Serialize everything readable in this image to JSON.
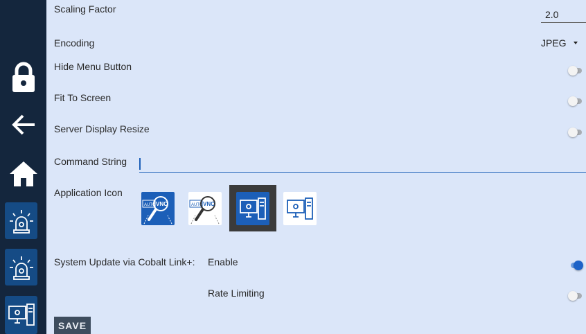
{
  "settings": {
    "scaling_factor": {
      "label": "Scaling Factor",
      "value": "2.0"
    },
    "encoding": {
      "label": "Encoding",
      "value": "JPEG"
    },
    "hide_menu_button": {
      "label": "Hide Menu Button",
      "on": false
    },
    "fit_to_screen": {
      "label": "Fit To Screen",
      "on": false
    },
    "server_display_resize": {
      "label": "Server Display Resize",
      "on": false
    },
    "command_string": {
      "label": "Command String",
      "value": ""
    },
    "application_icon": {
      "label": "Application Icon",
      "options": [
        {
          "name": "auto-vnc-dark",
          "badge": "AUTO",
          "text": "VNC",
          "selected": false
        },
        {
          "name": "auto-vnc-light",
          "badge": "AUTO",
          "text": "VNC",
          "selected": false
        },
        {
          "name": "computer-dark",
          "selected": true
        },
        {
          "name": "computer-light",
          "selected": false
        }
      ]
    },
    "system_update": {
      "label": "System Update via Cobalt Link+:",
      "sublabel": "Enable",
      "on": true
    },
    "rate_limiting": {
      "label": "Rate Limiting",
      "on": false
    }
  },
  "actions": {
    "save_label": "SAVE"
  },
  "rail": {
    "icons": [
      "lock-icon",
      "back-arrow-icon",
      "home-icon",
      "alarm-icon",
      "alarm-icon",
      "computer-icon"
    ]
  },
  "colors": {
    "rail_bg": "#14263d",
    "panel_bg": "#dbe6f9",
    "accent": "#1d63c8",
    "tile_bg": "#154b85"
  }
}
